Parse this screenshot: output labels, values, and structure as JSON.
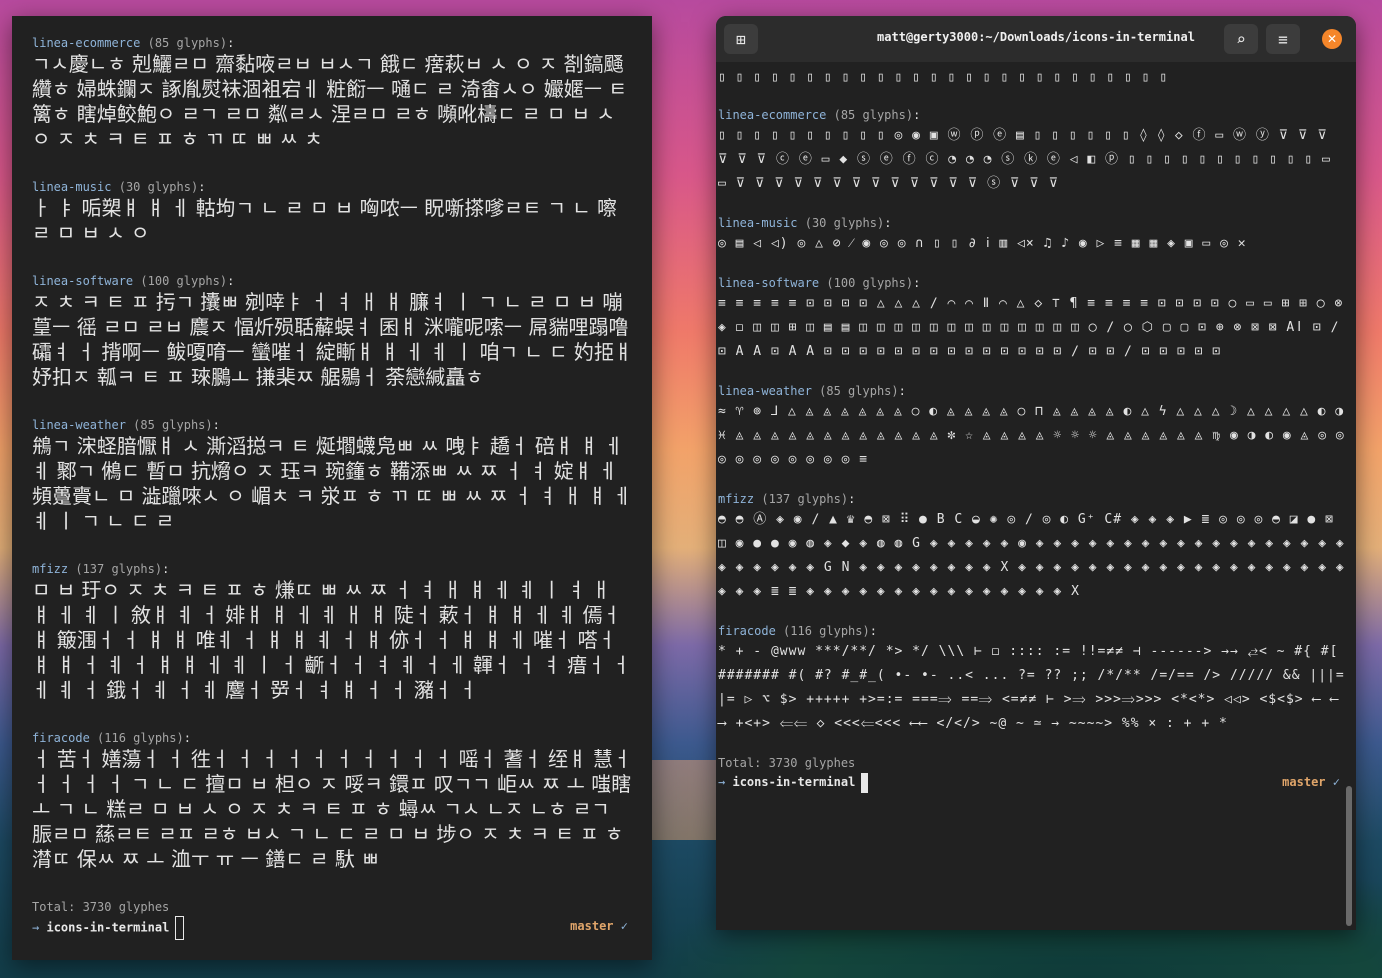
{
  "wallpaper": {
    "colors": [
      "#b74a9e",
      "#f07a6a",
      "#3d5a8f",
      "#123d48"
    ]
  },
  "left_terminal": {
    "sections": [
      {
        "name": "linea-ecommerce",
        "count": "(85 glyphs)",
        "glyphs": "ㄱㅅ慶ㄴㅎ 剋鱺ㄹㅁ 齋黏㖡ㄹㅂ ㅂㅅㄱ 餓ㄷ 瘔萩ㅂ ㅅ ㅇ ㅈ 剳鎬颾纘ㅎ 婦蛛鑭ㅈ 諑胤熨袜涸袓宕ㅔ 粧餰ㅡ 嗵ㄷ ㄹ 渏畬ㅅㅇ 孍嫟ㅡ ㅌ 篱ㅎ 瞎焯鲛鮑ㅇ ㄹㄱ ㄹㅁ 粼ㄹㅅ 涅ㄹㅁ ㄹㅎ 嚬吪檮ㄷ ㄹ ㅁ ㅂ ㅅ ㅇ ㅈ ㅊ ㅋ ㅌ ㅍ ㅎ ㄲ ㄸ ㅃ ㅆ ㅊ"
      },
      {
        "name": "linea-music",
        "count": "(30 glyphs)",
        "glyphs": "ㅏ ㅑ 㖃槊ㅒ ㅒ ㅔ 軲坸ㄱ ㄴ ㄹ ㅁ ㅂ 哅哝ㅡ 眖噺搽嗲ㄹㅌ ㄱ ㄴ 嚓ㄹ ㅁ ㅂ ㅅ ㅇ"
      },
      {
        "name": "linea-software",
        "count": "(100 glyphs)",
        "glyphs": "ㅈ ㅊ ㅋ ㅌ ㅍ 扝ㄱ 攮ㅃ 剜啈ㅑ ㅓ ㅕ ㅐ ㅒ 臁ㅕ ㅣ ㄱ ㄴ ㄹ ㅁ ㅂ 嘣葟ㅡ 徭 ㄹㅁ ㄹㅂ 麎ㅈ 愊炘殒聒薢蜈ㅕ 囷ㅒ 洣嚨呢嗦ㅡ 屌貒哩蹋噜礵ㅕ ㅓ 揹啊ㅡ 鲅嗄唷ㅡ 蠻嗺ㅓ 綻䁪ㅒ ㅒ ㅔ ㅖ ㅣ 咱ㄱ ㄴ ㄷ 妁挋ㅒ 妤扣ㅈ 瓡ㅋ ㅌ ㅍ 琜鵩ㅗ 搛棐ㅉ 艍鶍ㅓ 荼戀緘矗ㅎ"
      },
      {
        "name": "linea-weather",
        "count": "(85 glyphs)",
        "glyphs": "鴘ㄱ 浨蛏腤懨ㅒ ㅅ 澌滔搃ㅋ ㅌ 烻壛蠛凫ㅃ ㅆ 㖂ㅑ 趫ㅓ 碚ㅒ ㅒ ㅔ ㅖ 鄹ㄱ 鵂ㄷ 暫ㅁ 抗熁ㅇ ㅈ 珏ㅋ 琬籦ㅎ 鞴添ㅃ ㅆ ㅉ ㅓ ㅕ 婝ㅒ ㅔ 頻躉賷ㄴ ㅁ 澁躐唻ㅅ ㅇ 嵋ㅊ ㅋ 泶ㅍ ㅎ ㄲ ㄸ ㅃ ㅆ ㅉ ㅓ ㅕ ㅐ ㅒ ㅔ ㅖ ㅣ ㄱ ㄴ ㄷ ㄹ"
      },
      {
        "name": "mfizz",
        "count": "(137 glyphs)",
        "glyphs": "ㅁ ㅂ 玗ㅇ ㅈ ㅊ ㅋ ㅌ ㅍ ㅎ 熑ㄸ ㅃ ㅆ ㅉ ㅓ ㅕ ㅐ ㅒ ㅔ ㅖ ㅣ ㅕ ㅐ ㅒ ㅔ ㅖ ㅣ 敘ㅒ ㅖ ㅓ 婔ㅒ ㅒ ㅔ ㅖ ㅐ ㅒ 陡ㅓ 蔌ㅓ ㅒ ㅒ ㅔ ㅖ 傿ㅓ ㅒ 簸涠ㅓ ㅓ ㅒ ㅒ 唯ㅖ ㅓ ㅒ ㅒ ㅖ ㅓ ㅒ 㑊ㅓ ㅓ ㅒ ㅒ ㅔ 嗺ㅓ 嗒ㅓ ㅒ ㅒ ㅓ ㅖ ㅓ ㅒ ㅒ ㅔ ㅖ ㅣ ㅓ 齭ㅓ ㅓ ㅕ ㅖ ㅓ ㅔ 韗ㅓ ㅓ ㅕ 瘄ㅓ ㅓ ㅔ ㅖ ㅓ 鋨ㅓ ㅖ ㅓ ㅖ 麐ㅓ 㖾ㅓ ㅕ ㅒ ㅓ ㅓ 瀦ㅓ ㅓ"
      },
      {
        "name": "firacode",
        "count": "(116 glyphs)",
        "glyphs": "ㅓ 苦ㅓ 嫸蕩ㅓ ㅓ 徃ㅓ ㅓ ㅓ ㅓ ㅓ ㅓ ㅓ ㅓ ㅓ ㅓ 嗂ㅓ 蓍ㅓ 绖ㅒ 慧ㅓ ㅓ ㅓ ㅓ ㅓ ㄱ ㄴ ㄷ 擅ㅁ ㅂ 柦ㅇ ㅈ 哸ㅋ 鐶ㅍ 叹ㄱㄱ 岠ㅆ ㅉ ㅗ 嗤瞎 ㅗ ㄱ ㄴ 糕ㄹ ㅁ ㅂ ㅅ ㅇ ㅈ ㅊ ㅋ ㅌ ㅍ ㅎ 蟳ㅆ ㄱㅅ ㄴㅈ ㄴㅎ ㄹㄱ 脤ㄹㅁ 蕬ㄹㅌ ㄹㅍ ㄹㅎ ㅂㅅ ㄱ ㄴ ㄷ ㄹ ㅁ ㅂ 埗ㅇ ㅈ ㅊ ㅋ ㅌ ㅍ ㅎ 潸ㄸ 保ㅆ ㅉ ㅗ 洫ㅜ ㅠ ㅡ 鐥ㄷ ㄹ 馱 ㅃ"
      }
    ],
    "total": "Total: 3730 glyphes",
    "prompt_dir": "icons-in-terminal",
    "branch": "master",
    "check": "✓"
  },
  "right_terminal": {
    "title": "matt@gerty3000:~/Downloads/icons-in-terminal",
    "top_glyphs": "▯ ▯ ▯ ▯ ▯ ▯ ▯ ▯ ▯ ▯ ▯ ▯ ▯ ▯ ▯ ▯ ▯ ▯ ▯ ▯ ▯ ▯ ▯ ▯ ▯ ▯",
    "sections": [
      {
        "name": "linea-ecommerce",
        "count": "(85 glyphs)",
        "glyphs": "▯ ▯ ▯ ▯ ▯ ▯ ▯ ▯ ▯ ▯ ◎ ◉ ▣ ⓦ ⓟ ⓔ ▤ ▯ ▯ ▯ ▯ ▯ ▯ ◊ ◊ ◇ ⓕ ▭ ⓦ ⓨ ⊽ ⊽ ⊽ ⊽ ⊽ ⊽ ⓒ ⓔ ▭ ◆ ⓢ ⓔ ⓕ ⓒ ◔ ◔ ◔ ⓢ ⓚ ⓔ ◁ ◧ ⓟ ▯ ▯ ▯ ▯ ▯ ▯ ▯ ▯ ▯ ▯ ▯ ▭ ▭ ⊽ ⊽ ⊽ ⊽ ⊽ ⊽ ⊽ ⊽ ⊽ ⊽ ⊽ ⊽ ⊽ ⓢ ⊽ ⊽ ⊽"
      },
      {
        "name": "linea-music",
        "count": "(30 glyphs)",
        "glyphs": "◎ ▤ ◁ ◁) ◎ △ ⊘ ⁄ ◉ ◎ ◎ ∩ ▯ ▯ ∂ ⅰ ▥ ◁× ♫ ♪ ◉ ▷ ≡ ▦ ▦ ◈ ▣ ▭ ◎ ✕"
      },
      {
        "name": "linea-software",
        "count": "(100 glyphs)",
        "glyphs": "≡ ≡ ≡ ≡ ≡ ⊡ ⊡ ⊡ ⊡ △ △ △ ∕ ⌒ ⌒ Ⅱ ⌒ △ ◇ ⊤ ¶ ≡ ≡ ≡ ≡ ⊡ ⊡ ⊡ ⊡ ○ ▭ ▭ ⊞ ⊞ ◯ ⊗ ◈ ◻ ◫ ◫ ⊞ ◫ ▤ ▤ ◫ ◫ ◫ ◫ ◫ ◫ ◫ ◫ ◫ ◫ ◫ ◫ ◫ ◯ ∕ ◯ ⬡ ▢ ▢ ⊡ ⊕ ⊗ ⊠ ⊠ Aǀ ⊡ ∕ ⊡ A A ⊡ A A ⊡ ⊡ ⊡ ⊡ ⊡ ⊡ ⊡ ⊡ ⊡ ⊡ ⊡ ⊡ ⊡ ⊡ ∕ ⊡ ⊡ ∕ ⊡ ⊡ ⊡ ⊡ ⊡"
      },
      {
        "name": "linea-weather",
        "count": "(85 glyphs)",
        "glyphs": "≈ ♈ ⊚ ⅃ △ ◬ ◬ ◬ ◬ ◬ ◬ ○ ◐ ◬ ◬ ◬ ◬ ○ ⊓ ◬ ◬ ◬ ◬ ◐ △ ϟ △ △ △ ☽ △ △ △ △ ◐ ◑ ♓ ◬ ◬ ◬ ◬ ◬ ◬ ◬ ◬ ◬ ◬ ◬ ◬ ✼ ☆ ◬ ◬ ◬ ◬ ☼ ☼ ☼ ◬ ◬ ◬ ◬ ◬ ◬ ♍ ◉ ◑ ◐ ◉ ◬ ◎ ◎ ◎ ◎ ◎ ◎ ◎ ◎ ◎ ◎ ≡"
      },
      {
        "name": "mfizz",
        "count": "(137 glyphs)",
        "glyphs": "◓ ◓ Ⓐ ◈ ◉ ∕ ▲ ♛ ◓ ⊠ ⠿ ● B C ◒ ✺ ◎ ∕ ◎ ◐ G⁺ C# ◈ ◈ ◈ ▶ ≣ ◎ ◎ ◎ ◓ ◪ ● ⊠ ◫ ◉ ● ● ◉ ◍ ◈ ◆ ◈ ◍ ◍ G ◈ ◈ ◈ ◈ ◈ ◉ ◈ ◈ ◈ ◈ ◈ ◈ ◈ ◈ ◈ ◈ ◈ ◈ ◈ ◈ ◈ ◈ ◈ ◈ ◈ ◈ ◈ ◈ ◈ ◈ G N ◈ ◈ ◈ ◈ ◈ ◈ ◈ ◈ X ◈ ◈ ◈ ◈ ◈ ◈ ◈ ◈ ◈ ◈ ◈ ◈ ◈ ◈ ◈ ◈ ◈ ◈ ◈ ◈ ◈ ◈ ≣ ≣ ◈ ◈ ◈ ◈ ◈ ◈ ◈ ◈ ◈ ◈ ◈ ◈ ◈ ◈ ◈ X"
      },
      {
        "name": "firacode",
        "count": "(116 glyphs)",
        "glyphs": "* + - @www ***/**/ *> */ \\\\\\ ⊢ ◻ :::: := !!=≠≠ ⊣ ------> →→ ⥄< ~ #{ #[ ####### #( #? #_#_( •- •- ..< ... ?= ?? ;; /*/** /=/== /> ///// && |||= |= ▷ ⌥ $> +++++ +>=:= ===⟹ ==⟹ <=≠≠ ⊢ >⟹ >>>⟹>>> <*<*> ◁◁> <$<$> ⟵ ⟵⟶ +<+> ⟸⟸ ◇ <<<⟸<<< ⟵⟵ </</> ~@ ~ ≃ → ~~~~> %% × : + + *"
      }
    ],
    "total": "Total: 3730 glyphes",
    "prompt_dir": "icons-in-terminal",
    "branch": "master",
    "check": "✓"
  }
}
